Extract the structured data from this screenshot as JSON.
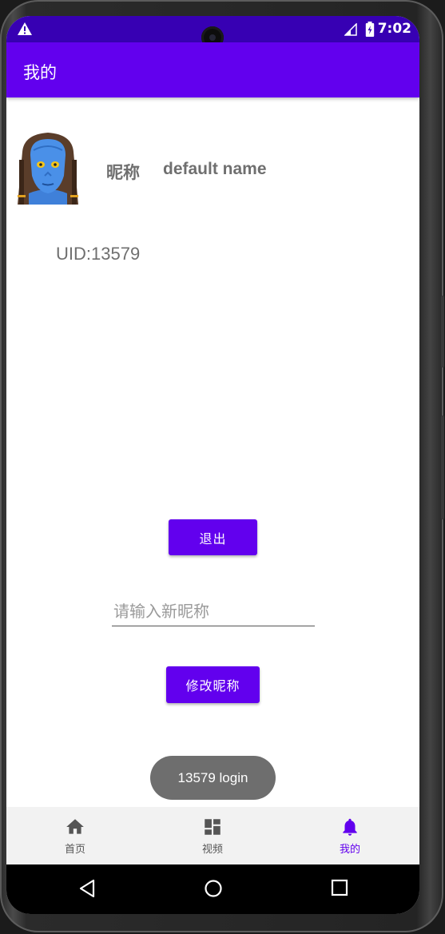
{
  "status_bar": {
    "time": "7:02",
    "icons": [
      "warning-icon",
      "signal-icon",
      "battery-icon"
    ]
  },
  "app_bar": {
    "title": "我的"
  },
  "profile": {
    "avatar": "avatar-image",
    "nickname_label": "昵称",
    "nickname_value": "default name",
    "uid": "UID:13579"
  },
  "actions": {
    "logout_label": "退出",
    "new_nickname_value": "",
    "new_nickname_placeholder": "请输入新昵称",
    "rename_label": "修改昵称"
  },
  "toast": {
    "message": "13579 login"
  },
  "bottom_nav": {
    "items": [
      {
        "label": "首页",
        "icon": "home-icon",
        "active": false
      },
      {
        "label": "视频",
        "icon": "dashboard-icon",
        "active": false
      },
      {
        "label": "我的",
        "icon": "bell-icon",
        "active": true
      }
    ]
  },
  "colors": {
    "primary": "#6200ee",
    "primary_dark": "#3700b3",
    "text_gray": "#6f6f6f",
    "toast_bg": "#6e6e6e",
    "nav_bg": "#f2f2f2"
  }
}
